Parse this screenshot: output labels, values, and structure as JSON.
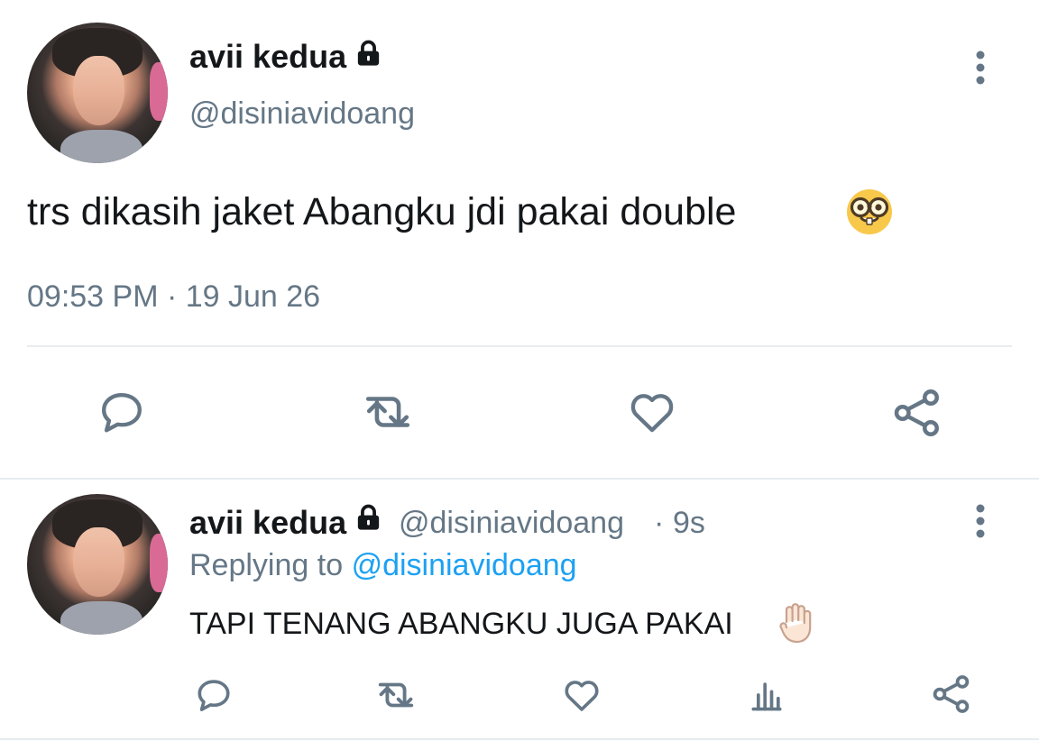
{
  "main_tweet": {
    "author": {
      "name": "avii kedua",
      "handle": "@disiniavidoang"
    },
    "text": "trs dikasih jaket Abangku jdi pakai double",
    "timestamp": "09:53 PM · 19 Jun 26",
    "icons": {
      "lock": "lock-icon",
      "more": "more-vertical-icon",
      "emoji": "nerd-face-emoji",
      "reply": "reply-icon",
      "retweet": "retweet-icon",
      "like": "like-icon",
      "share": "share-icon"
    }
  },
  "reply_tweet": {
    "author": {
      "name": "avii kedua",
      "handle": "@disiniavidoang",
      "separator": "·",
      "age": "9s"
    },
    "replying_to_label": "Replying to",
    "replying_to_handle": "@disiniavidoang",
    "text": "TAPI TENANG ABANGKU JUGA PAKAI",
    "icons": {
      "lock": "lock-icon",
      "more": "more-vertical-icon",
      "emoji": "raised-hand-emoji",
      "reply": "reply-icon",
      "retweet": "retweet-icon",
      "like": "like-icon",
      "analytics": "analytics-icon",
      "share": "share-icon"
    }
  },
  "colors": {
    "text_primary": "#14171a",
    "text_secondary": "#657786",
    "link": "#1da1f2",
    "divider": "#e6ecf0",
    "background": "#ffffff"
  }
}
